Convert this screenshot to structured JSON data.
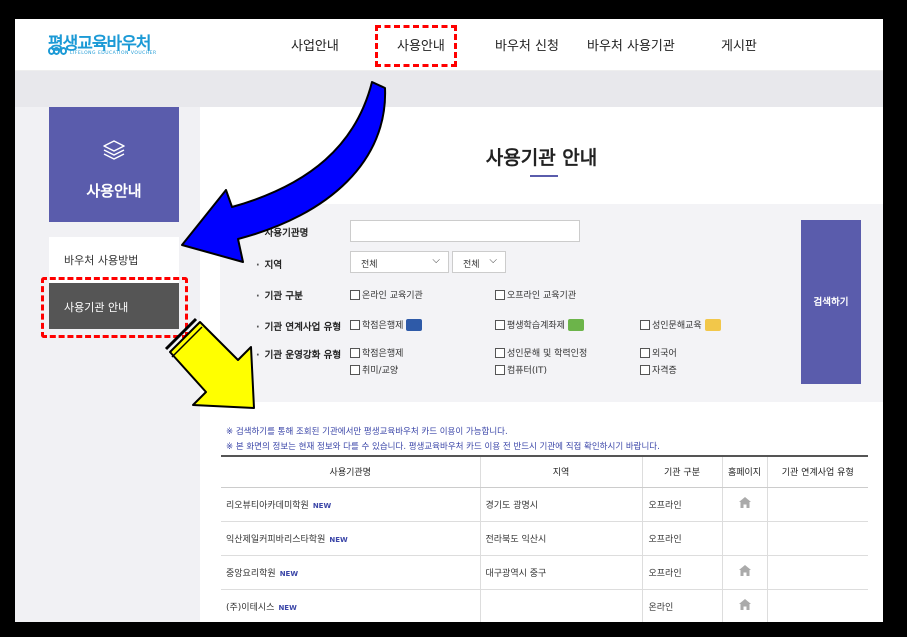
{
  "logo": {
    "title": "평생교육바우처",
    "subtitle": "LIFELONG EDUCATION VOUCHER"
  },
  "nav": [
    "사업안내",
    "사용안내",
    "바우처 신청",
    "바우처 사용기관",
    "게시판"
  ],
  "sidebar": {
    "title": "사용안내",
    "items": [
      "바우처 사용방법",
      "사용기관 안내"
    ]
  },
  "main": {
    "title": "사용기관 안내"
  },
  "search": {
    "name_label": "사용기관명",
    "region_label": "지역",
    "region_select1": "전체",
    "region_select2": "전체",
    "type_label": "기관 구분",
    "type_options": [
      "온라인 교육기관",
      "오프라인 교육기관"
    ],
    "link_label": "기관 연계사업 유형",
    "link_options": [
      "학점은행제",
      "평생학습계좌제",
      "성인문해교육"
    ],
    "strength_label": "기관 운영강화 유형",
    "strength_options": [
      "학점은행제",
      "성인문해 및 학력인정",
      "외국어",
      "취미/교양",
      "컴퓨터(IT)",
      "자격증"
    ],
    "button": "검색하기"
  },
  "notices": [
    "※ 검색하기를 통해 조회된 기관에서만 평생교육바우처 카드 이용이 가능합니다.",
    "※ 본 화면의 정보는 현재 정보와 다를 수 있습니다. 평생교육바우처 카드 이용 전 반드시 기관에 직접 확인하시기 바랍니다."
  ],
  "table": {
    "headers": [
      "사용기관명",
      "지역",
      "기관 구분",
      "홈페이지",
      "기관 연계사업 유형"
    ],
    "new_badge": "NEW",
    "rows": [
      {
        "name": "리오뷰티아카데미학원",
        "region": "경기도 광명시",
        "type": "오프라인",
        "home": true
      },
      {
        "name": "익산제일커피바리스타학원",
        "region": "전라북도 익산시",
        "type": "오프라인",
        "home": false
      },
      {
        "name": "중앙요리학원",
        "region": "대구광역시 중구",
        "type": "오프라인",
        "home": true
      },
      {
        "name": "(주)이테시스",
        "region": "",
        "type": "온라인",
        "home": true
      }
    ]
  },
  "colors": {
    "accent": "#5a5cac",
    "brand": "#1c9ad6",
    "highlight": "#ff0000",
    "arrow_blue": "#0000ff",
    "arrow_yellow": "#ffff00"
  }
}
